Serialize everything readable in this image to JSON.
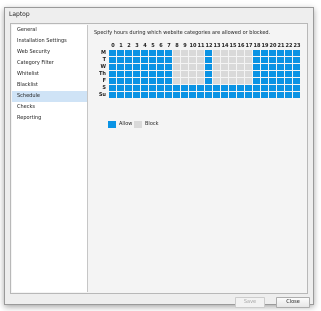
{
  "window": {
    "title": "Laptop"
  },
  "sidebar": {
    "items": [
      {
        "label": "General"
      },
      {
        "label": "Installation Settings"
      },
      {
        "label": "Web Security"
      },
      {
        "label": "Category Filter"
      },
      {
        "label": "Whitelist"
      },
      {
        "label": "Blacklist"
      },
      {
        "label": "Schedule"
      },
      {
        "label": "Checks"
      },
      {
        "label": "Reporting"
      }
    ],
    "active_index": 6
  },
  "schedule": {
    "instructions": "Specify hours during which website categories are allowed or blocked.",
    "hours": [
      "0",
      "1",
      "2",
      "3",
      "4",
      "5",
      "6",
      "7",
      "8",
      "9",
      "10",
      "11",
      "12",
      "13",
      "14",
      "15",
      "16",
      "17",
      "18",
      "19",
      "20",
      "21",
      "22",
      "23"
    ],
    "days": [
      "M",
      "T",
      "W",
      "Th",
      "F",
      "S",
      "Su"
    ],
    "grid": [
      "AAAAAAAABBBBABBBBBAAAAAA",
      "AAAAAAAABBBBABBBBBAAAAAA",
      "AAAAAAAABBBBABBBBBAAAAAA",
      "AAAAAAAABBBBABBBBBAAAAAA",
      "AAAAAAAABBBBABBBBBAAAAAA",
      "AAAAAAAAAAAAAAAAAAAAAAAA",
      "AAAAAAAAAAAAAAAAAAAAAAAA"
    ],
    "legend": {
      "allow_label": "Allow",
      "block_label": "Block"
    },
    "colors": {
      "allow": "#0a93e4",
      "block": "#d9d9d9"
    }
  },
  "buttons": {
    "save_label": "Save",
    "close_label": "Close"
  }
}
